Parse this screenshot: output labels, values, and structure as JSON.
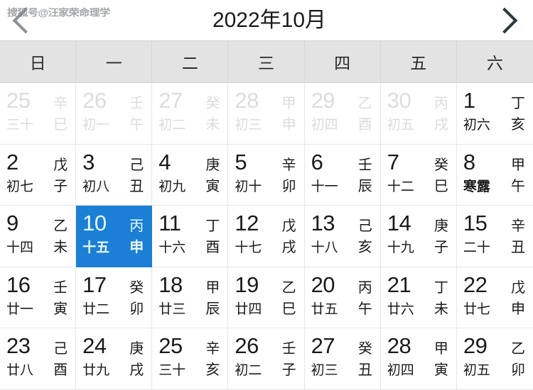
{
  "header": {
    "title": "2022年10月",
    "prev_label": "‹",
    "next_label": "›",
    "watermark": "搜狐号@汪家荣命理学"
  },
  "weekdays": [
    "日",
    "一",
    "二",
    "三",
    "四",
    "五",
    "六"
  ],
  "colors": {
    "selected_bg": "#1c7fd6",
    "selected_text": "#e9fbff",
    "header_bg": "#e3e3e3",
    "other_month_text": "#dcdcdc",
    "text": "#1a1a1a"
  },
  "days": [
    {
      "gregorian": "25",
      "lunar": "三十",
      "stem": "辛",
      "branch": "巳",
      "other_month": true,
      "selected": false,
      "term": false
    },
    {
      "gregorian": "26",
      "lunar": "初一",
      "stem": "壬",
      "branch": "午",
      "other_month": true,
      "selected": false,
      "term": false
    },
    {
      "gregorian": "27",
      "lunar": "初二",
      "stem": "癸",
      "branch": "未",
      "other_month": true,
      "selected": false,
      "term": false
    },
    {
      "gregorian": "28",
      "lunar": "初三",
      "stem": "甲",
      "branch": "申",
      "other_month": true,
      "selected": false,
      "term": false
    },
    {
      "gregorian": "29",
      "lunar": "初四",
      "stem": "乙",
      "branch": "酉",
      "other_month": true,
      "selected": false,
      "term": false
    },
    {
      "gregorian": "30",
      "lunar": "初五",
      "stem": "丙",
      "branch": "戌",
      "other_month": true,
      "selected": false,
      "term": false
    },
    {
      "gregorian": "1",
      "lunar": "初六",
      "stem": "丁",
      "branch": "亥",
      "other_month": false,
      "selected": false,
      "term": false
    },
    {
      "gregorian": "2",
      "lunar": "初七",
      "stem": "戊",
      "branch": "子",
      "other_month": false,
      "selected": false,
      "term": false
    },
    {
      "gregorian": "3",
      "lunar": "初八",
      "stem": "己",
      "branch": "丑",
      "other_month": false,
      "selected": false,
      "term": false
    },
    {
      "gregorian": "4",
      "lunar": "初九",
      "stem": "庚",
      "branch": "寅",
      "other_month": false,
      "selected": false,
      "term": false
    },
    {
      "gregorian": "5",
      "lunar": "初十",
      "stem": "辛",
      "branch": "卯",
      "other_month": false,
      "selected": false,
      "term": false
    },
    {
      "gregorian": "6",
      "lunar": "十一",
      "stem": "壬",
      "branch": "辰",
      "other_month": false,
      "selected": false,
      "term": false
    },
    {
      "gregorian": "7",
      "lunar": "十二",
      "stem": "癸",
      "branch": "巳",
      "other_month": false,
      "selected": false,
      "term": false
    },
    {
      "gregorian": "8",
      "lunar": "寒露",
      "stem": "甲",
      "branch": "午",
      "other_month": false,
      "selected": false,
      "term": true
    },
    {
      "gregorian": "9",
      "lunar": "十四",
      "stem": "乙",
      "branch": "未",
      "other_month": false,
      "selected": false,
      "term": false
    },
    {
      "gregorian": "10",
      "lunar": "十五",
      "stem": "丙",
      "branch": "申",
      "other_month": false,
      "selected": true,
      "term": false
    },
    {
      "gregorian": "11",
      "lunar": "十六",
      "stem": "丁",
      "branch": "酉",
      "other_month": false,
      "selected": false,
      "term": false
    },
    {
      "gregorian": "12",
      "lunar": "十七",
      "stem": "戊",
      "branch": "戌",
      "other_month": false,
      "selected": false,
      "term": false
    },
    {
      "gregorian": "13",
      "lunar": "十八",
      "stem": "己",
      "branch": "亥",
      "other_month": false,
      "selected": false,
      "term": false
    },
    {
      "gregorian": "14",
      "lunar": "十九",
      "stem": "庚",
      "branch": "子",
      "other_month": false,
      "selected": false,
      "term": false
    },
    {
      "gregorian": "15",
      "lunar": "二十",
      "stem": "辛",
      "branch": "丑",
      "other_month": false,
      "selected": false,
      "term": false
    },
    {
      "gregorian": "16",
      "lunar": "廿一",
      "stem": "壬",
      "branch": "寅",
      "other_month": false,
      "selected": false,
      "term": false
    },
    {
      "gregorian": "17",
      "lunar": "廿二",
      "stem": "癸",
      "branch": "卯",
      "other_month": false,
      "selected": false,
      "term": false
    },
    {
      "gregorian": "18",
      "lunar": "廿三",
      "stem": "甲",
      "branch": "辰",
      "other_month": false,
      "selected": false,
      "term": false
    },
    {
      "gregorian": "19",
      "lunar": "廿四",
      "stem": "乙",
      "branch": "巳",
      "other_month": false,
      "selected": false,
      "term": false
    },
    {
      "gregorian": "20",
      "lunar": "廿五",
      "stem": "丙",
      "branch": "午",
      "other_month": false,
      "selected": false,
      "term": false
    },
    {
      "gregorian": "21",
      "lunar": "廿六",
      "stem": "丁",
      "branch": "未",
      "other_month": false,
      "selected": false,
      "term": false
    },
    {
      "gregorian": "22",
      "lunar": "廿七",
      "stem": "戊",
      "branch": "申",
      "other_month": false,
      "selected": false,
      "term": false
    },
    {
      "gregorian": "23",
      "lunar": "廿八",
      "stem": "己",
      "branch": "酉",
      "other_month": false,
      "selected": false,
      "term": false
    },
    {
      "gregorian": "24",
      "lunar": "廿九",
      "stem": "庚",
      "branch": "戌",
      "other_month": false,
      "selected": false,
      "term": false
    },
    {
      "gregorian": "25",
      "lunar": "三十",
      "stem": "辛",
      "branch": "亥",
      "other_month": false,
      "selected": false,
      "term": false
    },
    {
      "gregorian": "26",
      "lunar": "初二",
      "stem": "壬",
      "branch": "子",
      "other_month": false,
      "selected": false,
      "term": false
    },
    {
      "gregorian": "27",
      "lunar": "初三",
      "stem": "癸",
      "branch": "丑",
      "other_month": false,
      "selected": false,
      "term": false
    },
    {
      "gregorian": "28",
      "lunar": "初四",
      "stem": "甲",
      "branch": "寅",
      "other_month": false,
      "selected": false,
      "term": false
    },
    {
      "gregorian": "29",
      "lunar": "初五",
      "stem": "乙",
      "branch": "卯",
      "other_month": false,
      "selected": false,
      "term": false
    }
  ]
}
